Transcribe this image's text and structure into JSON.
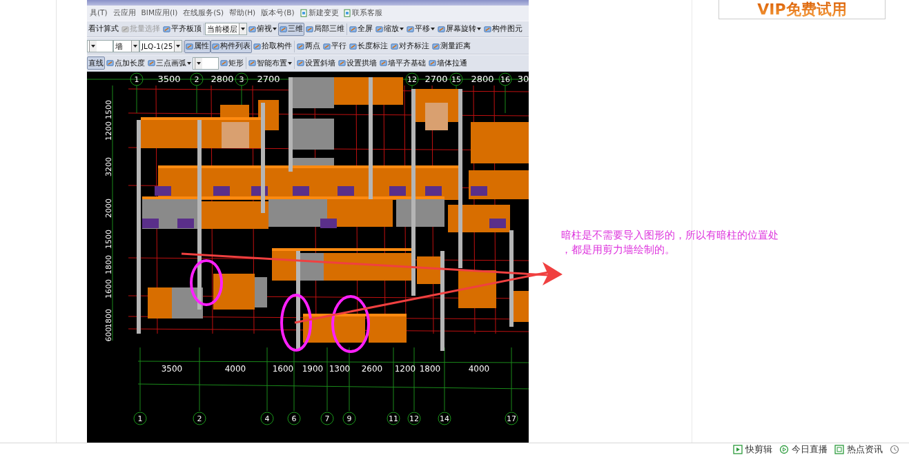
{
  "cad": {
    "menu": [
      {
        "label": "具(T)",
        "kind": "menu"
      },
      {
        "label": "云应用",
        "kind": "menu"
      },
      {
        "label": "BIM应用(I)",
        "kind": "menu"
      },
      {
        "label": "在线服务(S)",
        "kind": "menu"
      },
      {
        "label": "帮助(H)",
        "kind": "menu"
      },
      {
        "label": "版本号(B)",
        "kind": "menu"
      },
      {
        "label": "新建变更",
        "kind": "link"
      },
      {
        "label": "联系客服",
        "kind": "link"
      }
    ],
    "toolbars": [
      {
        "items": [
          {
            "kind": "tool",
            "label": "看计算式",
            "icon": false,
            "has_menu": false,
            "pressed": false,
            "disabled": false
          },
          {
            "kind": "tool",
            "label": "批量选择",
            "icon": true,
            "has_menu": false,
            "pressed": false,
            "disabled": true
          },
          {
            "kind": "tool",
            "label": "平齐板顶",
            "icon": true,
            "has_menu": false,
            "pressed": false,
            "disabled": false
          },
          {
            "kind": "separator"
          },
          {
            "kind": "select",
            "label": "当前楼层"
          },
          {
            "kind": "tool",
            "label": "俯视",
            "icon": true,
            "has_menu": true,
            "pressed": false,
            "disabled": false
          },
          {
            "kind": "tool",
            "label": "三维",
            "icon": true,
            "has_menu": false,
            "pressed": true,
            "disabled": false
          },
          {
            "kind": "tool",
            "label": "局部三维",
            "icon": true,
            "has_menu": false,
            "pressed": false,
            "disabled": false
          },
          {
            "kind": "separator"
          },
          {
            "kind": "tool",
            "label": "全屏",
            "icon": true,
            "has_menu": false,
            "pressed": false,
            "disabled": false
          },
          {
            "kind": "tool",
            "label": "缩放",
            "icon": true,
            "has_menu": true,
            "pressed": false,
            "disabled": false
          },
          {
            "kind": "tool",
            "label": "平移",
            "icon": true,
            "has_menu": true,
            "pressed": false,
            "disabled": false
          },
          {
            "kind": "tool",
            "label": "屏幕旋转",
            "icon": true,
            "has_menu": true,
            "pressed": false,
            "disabled": false
          },
          {
            "kind": "tool",
            "label": "构件图元",
            "icon": true,
            "has_menu": false,
            "pressed": false,
            "disabled": false
          }
        ]
      },
      {
        "items": [
          {
            "kind": "select"
          },
          {
            "kind": "select",
            "label": "墙"
          },
          {
            "kind": "select",
            "label": "JLQ-1(25"
          },
          {
            "kind": "separator"
          },
          {
            "kind": "tool",
            "label": "属性",
            "icon": true,
            "has_menu": false,
            "pressed": true,
            "disabled": false
          },
          {
            "kind": "tool",
            "label": "构件列表",
            "icon": true,
            "has_menu": false,
            "pressed": true,
            "disabled": false
          },
          {
            "kind": "tool",
            "label": "拾取构件",
            "icon": true,
            "has_menu": false,
            "pressed": false,
            "disabled": false
          },
          {
            "kind": "separator"
          },
          {
            "kind": "tool",
            "label": "两点",
            "icon": true,
            "has_menu": false,
            "pressed": false,
            "disabled": false
          },
          {
            "kind": "tool",
            "label": "平行",
            "icon": true,
            "has_menu": false,
            "pressed": false,
            "disabled": false
          },
          {
            "kind": "tool",
            "label": "长度标注",
            "icon": true,
            "has_menu": false,
            "pressed": false,
            "disabled": false
          },
          {
            "kind": "tool",
            "label": "对齐标注",
            "icon": true,
            "has_menu": false,
            "pressed": false,
            "disabled": false
          },
          {
            "kind": "tool",
            "label": "测量距离",
            "icon": true,
            "has_menu": false,
            "pressed": false,
            "disabled": false
          }
        ]
      },
      {
        "items": [
          {
            "kind": "tool",
            "label": "直线",
            "icon": false,
            "has_menu": false,
            "pressed": true,
            "disabled": false
          },
          {
            "kind": "tool",
            "label": "点加长度",
            "icon": true,
            "has_menu": false,
            "pressed": false,
            "disabled": false
          },
          {
            "kind": "tool",
            "label": "三点画弧",
            "icon": true,
            "has_menu": true,
            "pressed": false,
            "disabled": false
          },
          {
            "kind": "select"
          },
          {
            "kind": "tool",
            "label": "矩形",
            "icon": true,
            "has_menu": false,
            "pressed": false,
            "disabled": false
          },
          {
            "kind": "separator"
          },
          {
            "kind": "tool",
            "label": "智能布置",
            "icon": true,
            "has_menu": true,
            "pressed": false,
            "disabled": false
          },
          {
            "kind": "separator"
          },
          {
            "kind": "tool",
            "label": "设置斜墙",
            "icon": true,
            "has_menu": false,
            "pressed": false,
            "disabled": false
          },
          {
            "kind": "tool",
            "label": "设置拱墙",
            "icon": true,
            "has_menu": false,
            "pressed": false,
            "disabled": false
          },
          {
            "kind": "tool",
            "label": "墙平齐基础",
            "icon": true,
            "has_menu": false,
            "pressed": false,
            "disabled": false
          },
          {
            "kind": "tool",
            "label": "墙体拉通",
            "icon": true,
            "has_menu": false,
            "pressed": false,
            "disabled": false
          }
        ]
      }
    ],
    "view": {
      "top_axes": [
        "1",
        "2",
        "3",
        "12",
        "15",
        "16"
      ],
      "top_dims": [
        "3500",
        "2800",
        "2700",
        "2700",
        "2800",
        "30"
      ],
      "left_dims": [
        "1500",
        "1200",
        "3200",
        "2000",
        "1500",
        "1800",
        "1600",
        "1800",
        "600"
      ],
      "bottom_dims": [
        "3500",
        "4000",
        "1600",
        "1900",
        "1300",
        "2600",
        "1200",
        "1800",
        "4000"
      ],
      "bottom_axes": [
        "1",
        "2",
        "4",
        "6",
        "7",
        "9",
        "11",
        "12",
        "14",
        "17"
      ]
    }
  },
  "annotation": {
    "lines": [
      "暗柱是不需要导入图形的，所以有暗柱的位置处",
      "，都是用剪力墙绘制的。"
    ]
  },
  "banner": {
    "label": "VIP免费试用"
  },
  "status_bar": [
    {
      "label": "快剪辑",
      "kind": "clip"
    },
    {
      "label": "今日直播",
      "kind": "live"
    },
    {
      "label": "热点资讯",
      "kind": "news"
    },
    {
      "kind": "history"
    }
  ]
}
